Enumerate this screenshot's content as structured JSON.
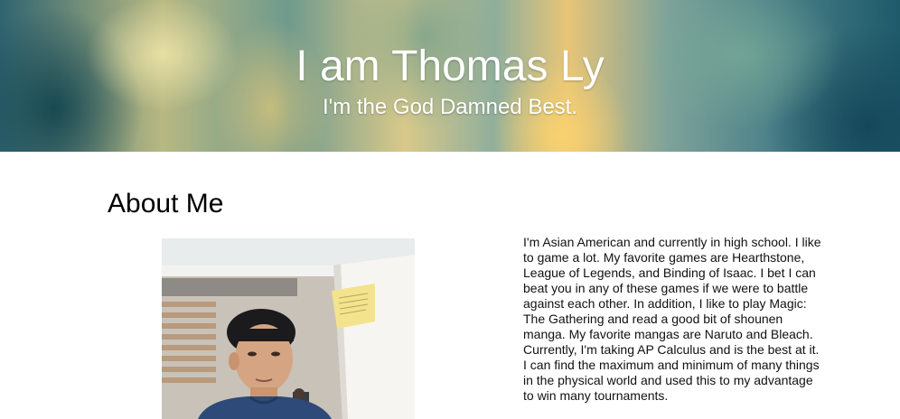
{
  "header": {
    "title": "I am Thomas Ly",
    "subtitle": "I'm the God Damned Best."
  },
  "about": {
    "heading": "About Me",
    "paragraph": "I'm Asian American and currently in high school. I like to game a lot. My favorite games are Hearthstone, League of Legends, and Binding of Isaac. I bet I can beat you in any of these games if we were to battle against each other. In addition, I like to play Magic: The Gathering and read a good bit of shounen manga. My favorite mangas are Naruto and Bleach. Currently, I'm taking AP Calculus and is the best at it. I can find the maximum and minimum of many things in the physical world and used this to my advantage to win many tournaments."
  }
}
